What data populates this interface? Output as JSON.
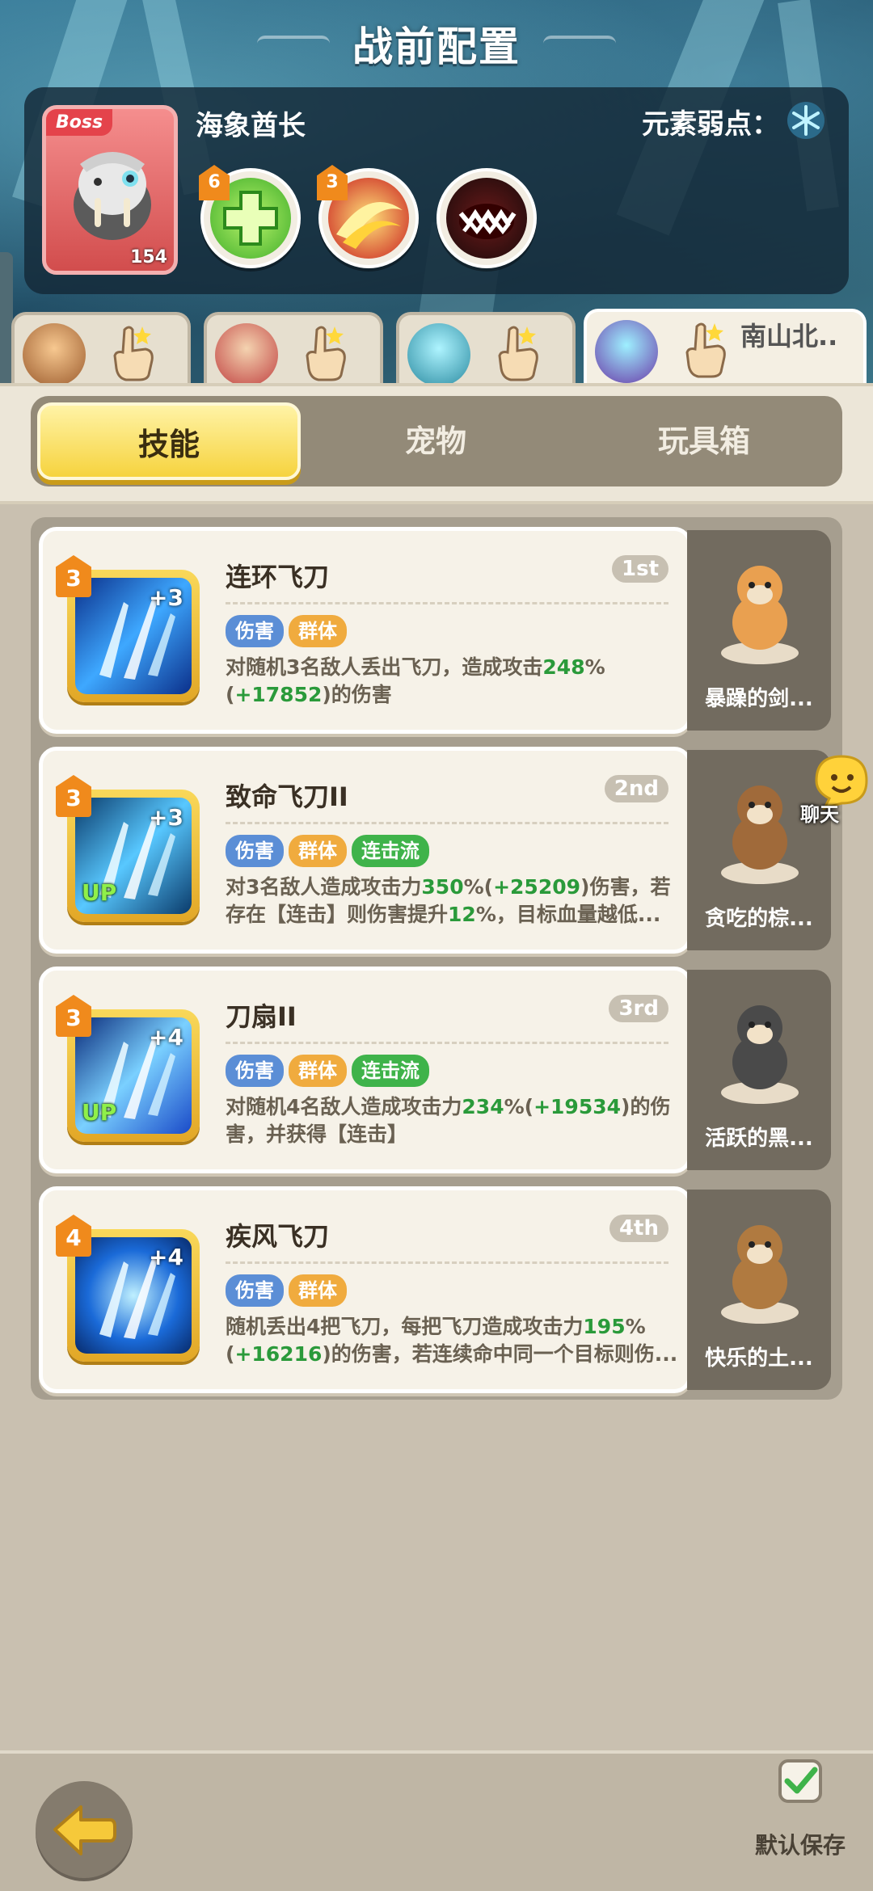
{
  "header": {
    "title": "战前配置"
  },
  "boss": {
    "tag": "Boss",
    "level": "154",
    "name": "海象酋长",
    "weakness_label": "元素弱点：",
    "weakness_icon": "snowflake-icon",
    "skills": [
      {
        "icon": "heal-cross-icon",
        "count": "6"
      },
      {
        "icon": "fire-slash-icon",
        "count": "3"
      },
      {
        "icon": "monster-maw-icon",
        "count": ""
      }
    ]
  },
  "heroes": [
    {
      "avatar": "hero-bearded-avatar",
      "active": false
    },
    {
      "avatar": "hero-redhair-avatar",
      "active": false
    },
    {
      "avatar": "hero-cyan-avatar",
      "active": false
    },
    {
      "avatar": "hero-purple-avatar",
      "name": "南山北..",
      "active": true
    }
  ],
  "tabs": [
    {
      "label": "技能",
      "active": true
    },
    {
      "label": "宠物",
      "active": false
    },
    {
      "label": "玩具箱",
      "active": false
    }
  ],
  "skills": [
    {
      "level": "3",
      "plus": "+3",
      "up": "",
      "title": "连环飞刀",
      "rank": "1st",
      "tags": [
        {
          "text": "伤害",
          "color": "blue"
        },
        {
          "text": "群体",
          "color": "orange"
        }
      ],
      "desc_parts": [
        {
          "t": "对随机3名敌人丢出飞刀，造成攻击"
        },
        {
          "t": "248",
          "h": true
        },
        {
          "t": "%("
        },
        {
          "t": "+17852",
          "h": true
        },
        {
          "t": ")的伤害"
        }
      ],
      "pet_name": "暴躁的剑..."
    },
    {
      "level": "3",
      "plus": "+3",
      "up": "UP",
      "title": "致命飞刀II",
      "rank": "2nd",
      "tags": [
        {
          "text": "伤害",
          "color": "blue"
        },
        {
          "text": "群体",
          "color": "orange"
        },
        {
          "text": "连击流",
          "color": "green"
        }
      ],
      "desc_parts": [
        {
          "t": "对3名敌人造成攻击力"
        },
        {
          "t": "350",
          "h": true
        },
        {
          "t": "%("
        },
        {
          "t": "+25209",
          "h": true
        },
        {
          "t": ")伤害，若存在【连击】则伤害提升"
        },
        {
          "t": "12",
          "h": true
        },
        {
          "t": "%，目标血量越低..."
        }
      ],
      "pet_name": "贪吃的棕..."
    },
    {
      "level": "3",
      "plus": "+4",
      "up": "UP",
      "title": "刀扇II",
      "rank": "3rd",
      "tags": [
        {
          "text": "伤害",
          "color": "blue"
        },
        {
          "text": "群体",
          "color": "orange"
        },
        {
          "text": "连击流",
          "color": "green"
        }
      ],
      "desc_parts": [
        {
          "t": "对随机4名敌人造成攻击力"
        },
        {
          "t": "234",
          "h": true
        },
        {
          "t": "%("
        },
        {
          "t": "+19534",
          "h": true
        },
        {
          "t": ")的伤害，并获得【连击】"
        }
      ],
      "pet_name": "活跃的黑..."
    },
    {
      "level": "4",
      "plus": "+4",
      "up": "",
      "title": "疾风飞刀",
      "rank": "4th",
      "tags": [
        {
          "text": "伤害",
          "color": "blue"
        },
        {
          "text": "群体",
          "color": "orange"
        }
      ],
      "desc_parts": [
        {
          "t": "随机丢出4把飞刀，每把飞刀造成攻击力"
        },
        {
          "t": "195",
          "h": true
        },
        {
          "t": "%("
        },
        {
          "t": "+16216",
          "h": true
        },
        {
          "t": ")的伤害，若连续命中同一个目标则伤..."
        }
      ],
      "pet_name": "快乐的土..."
    }
  ],
  "chat": {
    "label": "聊天"
  },
  "footer": {
    "save_label": "默认保存"
  }
}
